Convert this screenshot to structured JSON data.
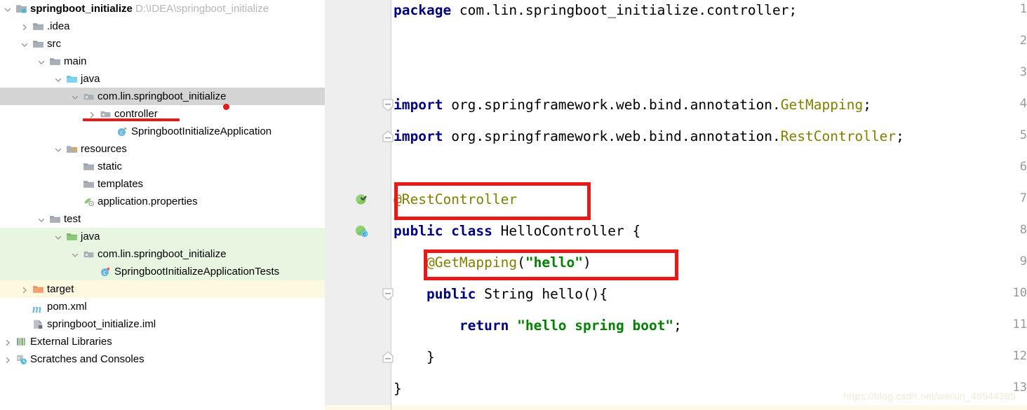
{
  "project": {
    "name": "springboot_initialize",
    "path": "D:\\IDEA\\springboot_initialize"
  },
  "tree": {
    "items": [
      {
        "label": "springboot_initialize",
        "suffix": "D:\\IDEA\\springboot_initialize",
        "icon": "module-icon",
        "arrow": "expanded",
        "depth": 0,
        "bold": true,
        "state": "none"
      },
      {
        "label": ".idea",
        "suffix": "",
        "icon": "folder-icon",
        "arrow": "collapsed",
        "depth": 1,
        "bold": false,
        "state": "none"
      },
      {
        "label": "src",
        "suffix": "",
        "icon": "folder-icon",
        "arrow": "expanded",
        "depth": 1,
        "bold": false,
        "state": "none"
      },
      {
        "label": "main",
        "suffix": "",
        "icon": "folder-icon",
        "arrow": "expanded",
        "depth": 2,
        "bold": false,
        "state": "none"
      },
      {
        "label": "java",
        "suffix": "",
        "icon": "source-folder-icon",
        "arrow": "expanded",
        "depth": 3,
        "bold": false,
        "state": "none"
      },
      {
        "label": "com.lin.springboot_initialize",
        "suffix": "",
        "icon": "package-icon",
        "arrow": "expanded",
        "depth": 4,
        "bold": false,
        "state": "selected"
      },
      {
        "label": "controller",
        "suffix": "",
        "icon": "package-icon",
        "arrow": "collapsed",
        "depth": 5,
        "bold": false,
        "state": "none"
      },
      {
        "label": "SpringbootInitializeApplication",
        "suffix": "",
        "icon": "spring-class-icon",
        "arrow": "none",
        "depth": 6,
        "bold": false,
        "state": "none"
      },
      {
        "label": "resources",
        "suffix": "",
        "icon": "resources-folder-icon",
        "arrow": "expanded",
        "depth": 3,
        "bold": false,
        "state": "none"
      },
      {
        "label": "static",
        "suffix": "",
        "icon": "folder-icon",
        "arrow": "none",
        "depth": 4,
        "bold": false,
        "state": "none"
      },
      {
        "label": "templates",
        "suffix": "",
        "icon": "folder-icon",
        "arrow": "none",
        "depth": 4,
        "bold": false,
        "state": "none"
      },
      {
        "label": "application.properties",
        "suffix": "",
        "icon": "properties-icon",
        "arrow": "none",
        "depth": 4,
        "bold": false,
        "state": "none"
      },
      {
        "label": "test",
        "suffix": "",
        "icon": "folder-icon",
        "arrow": "expanded",
        "depth": 2,
        "bold": false,
        "state": "none"
      },
      {
        "label": "java",
        "suffix": "",
        "icon": "test-source-folder-icon",
        "arrow": "expanded",
        "depth": 3,
        "bold": false,
        "state": "test"
      },
      {
        "label": "com.lin.springboot_initialize",
        "suffix": "",
        "icon": "package-icon",
        "arrow": "expanded",
        "depth": 4,
        "bold": false,
        "state": "test"
      },
      {
        "label": "SpringbootInitializeApplicationTests",
        "suffix": "",
        "icon": "test-class-icon",
        "arrow": "none",
        "depth": 5,
        "bold": false,
        "state": "test"
      },
      {
        "label": "target",
        "suffix": "",
        "icon": "excluded-folder-icon",
        "arrow": "collapsed",
        "depth": 1,
        "bold": false,
        "state": "excluded"
      },
      {
        "label": "pom.xml",
        "suffix": "",
        "icon": "maven-icon",
        "arrow": "none",
        "depth": 1,
        "bold": false,
        "state": "none"
      },
      {
        "label": "springboot_initialize.iml",
        "suffix": "",
        "icon": "iml-icon",
        "arrow": "none",
        "depth": 1,
        "bold": false,
        "state": "none"
      },
      {
        "label": "External Libraries",
        "suffix": "",
        "icon": "libraries-icon",
        "arrow": "collapsed",
        "depth": 0,
        "bold": false,
        "state": "none"
      },
      {
        "label": "Scratches and Consoles",
        "suffix": "",
        "icon": "scratches-icon",
        "arrow": "collapsed",
        "depth": 0,
        "bold": false,
        "state": "none"
      }
    ]
  },
  "editor": {
    "line_numbers": [
      "1",
      "2",
      "3",
      "4",
      "5",
      "6",
      "7",
      "8",
      "9",
      "10",
      "11",
      "12",
      "13"
    ],
    "lines": [
      {
        "n": 1,
        "tokens": [
          {
            "t": "package ",
            "c": "kw"
          },
          {
            "t": "com.lin.springboot_initialize.controller;",
            "c": "pl"
          }
        ]
      },
      {
        "n": 2,
        "tokens": []
      },
      {
        "n": 3,
        "tokens": []
      },
      {
        "n": 4,
        "tokens": [
          {
            "t": "import ",
            "c": "kw"
          },
          {
            "t": "org.springframework.web.bind.annotation.",
            "c": "pl"
          },
          {
            "t": "GetMapping",
            "c": "ann"
          },
          {
            "t": ";",
            "c": "pl"
          }
        ]
      },
      {
        "n": 5,
        "tokens": [
          {
            "t": "import ",
            "c": "kw"
          },
          {
            "t": "org.springframework.web.bind.annotation.",
            "c": "pl"
          },
          {
            "t": "RestController",
            "c": "ann"
          },
          {
            "t": ";",
            "c": "pl"
          }
        ]
      },
      {
        "n": 6,
        "tokens": []
      },
      {
        "n": 7,
        "tokens": [
          {
            "t": "@RestController",
            "c": "ann"
          }
        ]
      },
      {
        "n": 8,
        "tokens": [
          {
            "t": "public class ",
            "c": "kw"
          },
          {
            "t": "HelloController {",
            "c": "pl"
          }
        ]
      },
      {
        "n": 9,
        "tokens": [
          {
            "t": "    ",
            "c": "pl"
          },
          {
            "t": "@GetMapping",
            "c": "ann"
          },
          {
            "t": "(",
            "c": "pl"
          },
          {
            "t": "\"hello\"",
            "c": "str"
          },
          {
            "t": ")",
            "c": "pl"
          }
        ]
      },
      {
        "n": 10,
        "tokens": [
          {
            "t": "    ",
            "c": "pl"
          },
          {
            "t": "public ",
            "c": "kw"
          },
          {
            "t": "String hello(){",
            "c": "pl"
          }
        ]
      },
      {
        "n": 11,
        "tokens": [
          {
            "t": "        ",
            "c": "pl"
          },
          {
            "t": "return ",
            "c": "kw"
          },
          {
            "t": "\"hello spring boot\"",
            "c": "str"
          },
          {
            "t": ";",
            "c": "pl"
          }
        ]
      },
      {
        "n": 12,
        "tokens": [
          {
            "t": "    }",
            "c": "pl"
          }
        ]
      },
      {
        "n": 13,
        "tokens": [
          {
            "t": "}",
            "c": "pl"
          }
        ]
      }
    ],
    "gutter_icons": [
      {
        "line": 7,
        "icon": "spring-bean-check-icon"
      },
      {
        "line": 8,
        "icon": "spring-bean-class-icon"
      }
    ],
    "fold_markers": [
      {
        "line": 4,
        "icon": "fold-start-icon"
      },
      {
        "line": 5,
        "icon": "fold-end-icon"
      },
      {
        "line": 10,
        "icon": "fold-start-icon"
      },
      {
        "line": 12,
        "icon": "fold-end-icon"
      }
    ]
  },
  "annotations": {
    "color": "#e81919",
    "boxes": [
      {
        "name": "rest-controller-highlight",
        "target": "@RestController"
      },
      {
        "name": "get-mapping-highlight",
        "target": "@GetMapping(\"hello\")"
      }
    ],
    "underline_target": "controller",
    "dot": true
  },
  "watermark": {
    "text": "https://blog.csdn.net/weixin_46544385"
  }
}
